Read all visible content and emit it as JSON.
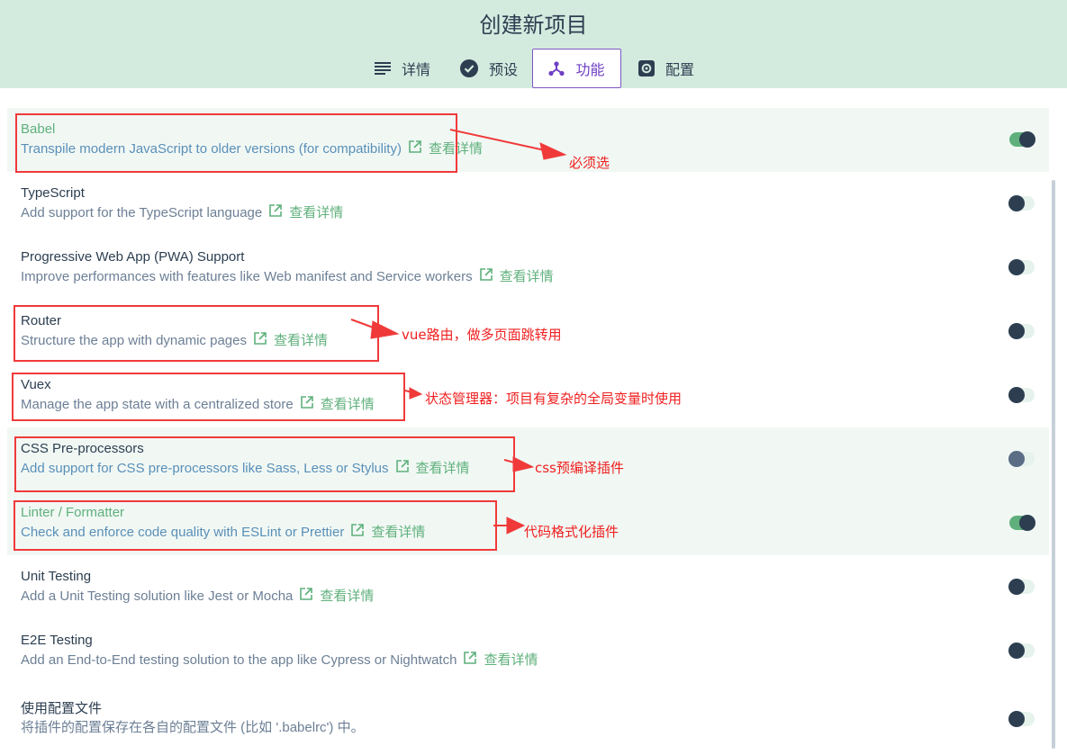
{
  "title": "创建新项目",
  "tabs": [
    {
      "label": "详情",
      "icon": "details-icon"
    },
    {
      "label": "预设",
      "icon": "check-circle-icon"
    },
    {
      "label": "功能",
      "icon": "features-icon",
      "active": true
    },
    {
      "label": "配置",
      "icon": "settings-icon"
    }
  ],
  "more_label": "查看详情",
  "features": [
    {
      "name": "Babel",
      "desc": "Transpile modern JavaScript to older versions (for compatibility)",
      "link": true,
      "enabled": true,
      "selected": true
    },
    {
      "name": "TypeScript",
      "desc": "Add support for the TypeScript language",
      "link": true,
      "enabled": false
    },
    {
      "name": "Progressive Web App (PWA) Support",
      "desc": "Improve performances with features like Web manifest and Service workers",
      "link": true,
      "enabled": false
    },
    {
      "name": "Router",
      "desc": "Structure the app with dynamic pages",
      "link": true,
      "enabled": false
    },
    {
      "name": "Vuex",
      "desc": "Manage the app state with a centralized store",
      "link": true,
      "enabled": false
    },
    {
      "name": "CSS Pre-processors",
      "desc": "Add support for CSS pre-processors like Sass, Less or Stylus",
      "link": true,
      "enabled": false,
      "selected": true
    },
    {
      "name": "Linter / Formatter",
      "desc": "Check and enforce code quality with ESLint or Prettier",
      "link": true,
      "enabled": true,
      "selected": true
    },
    {
      "name": "Unit Testing",
      "desc": "Add a Unit Testing solution like Jest or Mocha",
      "link": true,
      "enabled": false
    },
    {
      "name": "E2E Testing",
      "desc": "Add an End-to-End testing solution to the app like Cypress or Nightwatch",
      "link": true,
      "enabled": false
    },
    {
      "name": "使用配置文件",
      "desc": "将插件的配置保存在各自的配置文件 (比如 '.babelrc') 中。",
      "link": false,
      "enabled": false
    }
  ],
  "annotations": [
    "必须选",
    "vue路由，做多页面跳转用",
    "状态管理器：项目有复杂的全局变量时使用",
    "css预编译插件",
    "代码格式化插件"
  ],
  "colors": {
    "header_bg": "#d3ebdf",
    "accent_green": "#5fb07c",
    "active_tab": "#7e57c2",
    "annotation_red": "#f03a3a"
  }
}
